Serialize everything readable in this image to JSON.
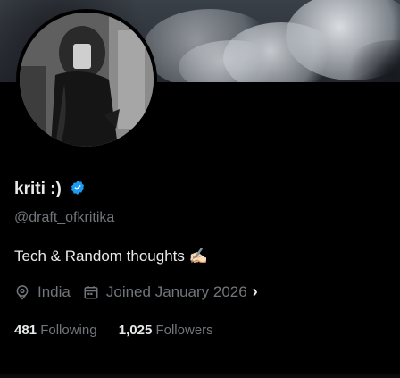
{
  "profile": {
    "display_name": "kriti :)",
    "handle": "@draft_ofkritika",
    "bio": "Tech & Random thoughts ✍🏻",
    "location": "India",
    "joined": "Joined January 2026",
    "verified_color": "#1d9bf0"
  },
  "stats": {
    "following_count": "481",
    "following_label": "Following",
    "followers_count": "1,025",
    "followers_label": "Followers"
  },
  "icons": {
    "location": "location-pin-icon",
    "calendar": "calendar-icon",
    "verified": "verified-badge-icon",
    "more": "chevron-right-icon"
  }
}
